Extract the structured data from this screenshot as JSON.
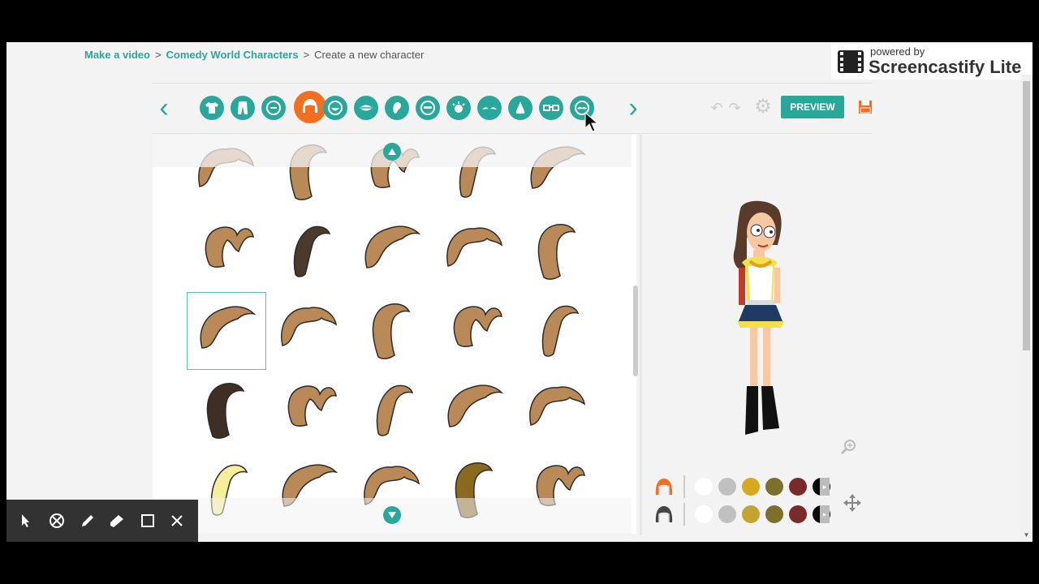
{
  "breadcrumb": {
    "items": [
      {
        "label": "Make a video",
        "link": true
      },
      {
        "label": "Comedy World Characters",
        "link": true
      },
      {
        "label": "Create a new character",
        "link": false
      }
    ],
    "separator": ">"
  },
  "watermark": {
    "line1": "powered by",
    "line2": "Screencastify Lite"
  },
  "toolbar": {
    "prev_icon": "chevron-left-icon",
    "next_icon": "chevron-right-icon",
    "categories": [
      {
        "name": "shirt",
        "icon": "shirt-icon",
        "active": false
      },
      {
        "name": "pants",
        "icon": "pants-icon",
        "active": false
      },
      {
        "name": "face-shape",
        "icon": "face-icon",
        "active": false
      },
      {
        "name": "hair",
        "icon": "hair-icon",
        "active": true
      },
      {
        "name": "beard",
        "icon": "beard-icon",
        "active": false
      },
      {
        "name": "mouth",
        "icon": "mouth-icon",
        "active": false
      },
      {
        "name": "ear",
        "icon": "ear-icon",
        "active": false
      },
      {
        "name": "forehead",
        "icon": "forehead-icon",
        "active": false
      },
      {
        "name": "eye",
        "icon": "eye-icon",
        "active": false
      },
      {
        "name": "eyebrow",
        "icon": "eyebrow-icon",
        "active": false
      },
      {
        "name": "nose",
        "icon": "nose-icon",
        "active": false
      },
      {
        "name": "glasses",
        "icon": "glasses-icon",
        "active": false
      },
      {
        "name": "mustache",
        "icon": "mustache-icon",
        "active": false
      }
    ],
    "preview_label": "PREVIEW",
    "undo_icon": "undo-icon",
    "redo_icon": "redo-icon",
    "settings_icon": "gear-icon",
    "save_icon": "save-icon"
  },
  "hair_grid": {
    "selected_index": 10,
    "items": [
      {
        "color": "#b98a57"
      },
      {
        "color": "#b98a57"
      },
      {
        "color": "#b98a57"
      },
      {
        "color": "#b98a57"
      },
      {
        "color": "#b98a57"
      },
      {
        "color": "#b98a57"
      },
      {
        "color": "#4a3a2c"
      },
      {
        "color": "#b98a57"
      },
      {
        "color": "#b98a57"
      },
      {
        "color": "#b98a57"
      },
      {
        "color": "#b98a57"
      },
      {
        "color": "#b98a57"
      },
      {
        "color": "#b98a57"
      },
      {
        "color": "#b98a57"
      },
      {
        "color": "#b98a57"
      },
      {
        "color": "#3e2f25"
      },
      {
        "color": "#b98a57"
      },
      {
        "color": "#b98a57"
      },
      {
        "color": "#b98a57"
      },
      {
        "color": "#b98a57"
      },
      {
        "color": "#f5ee9a"
      },
      {
        "color": "#b98a57"
      },
      {
        "color": "#b98a57"
      },
      {
        "color": "#8a6a1f"
      },
      {
        "color": "#b98a57"
      }
    ],
    "scroll_up_icon": "scroll-up-icon",
    "scroll_down_icon": "scroll-down-icon"
  },
  "colors": {
    "accent": "#2aa79b",
    "active": "#f26f21",
    "row1": {
      "part_icon": "hair-color-icon",
      "swatches": [
        "#ffffff",
        "#c0c0c0",
        "#d8a91f",
        "#7d6f2c",
        "#7b2a2a",
        "#0a0a0a"
      ]
    },
    "row2": {
      "part_icon": "hair-shade-icon",
      "swatches": [
        "#ffffff",
        "#c0c0c0",
        "#c2a433",
        "#7d6f2c",
        "#7b2a2a",
        "#0a0a0a"
      ]
    }
  },
  "misc": {
    "zoom_icon": "zoom-icon",
    "move_icon": "move-icon"
  },
  "annotation_toolbar": {
    "tools": [
      "pointer-icon",
      "eraser-icon",
      "pen-icon",
      "highlighter-icon",
      "rectangle-icon",
      "close-icon"
    ]
  }
}
